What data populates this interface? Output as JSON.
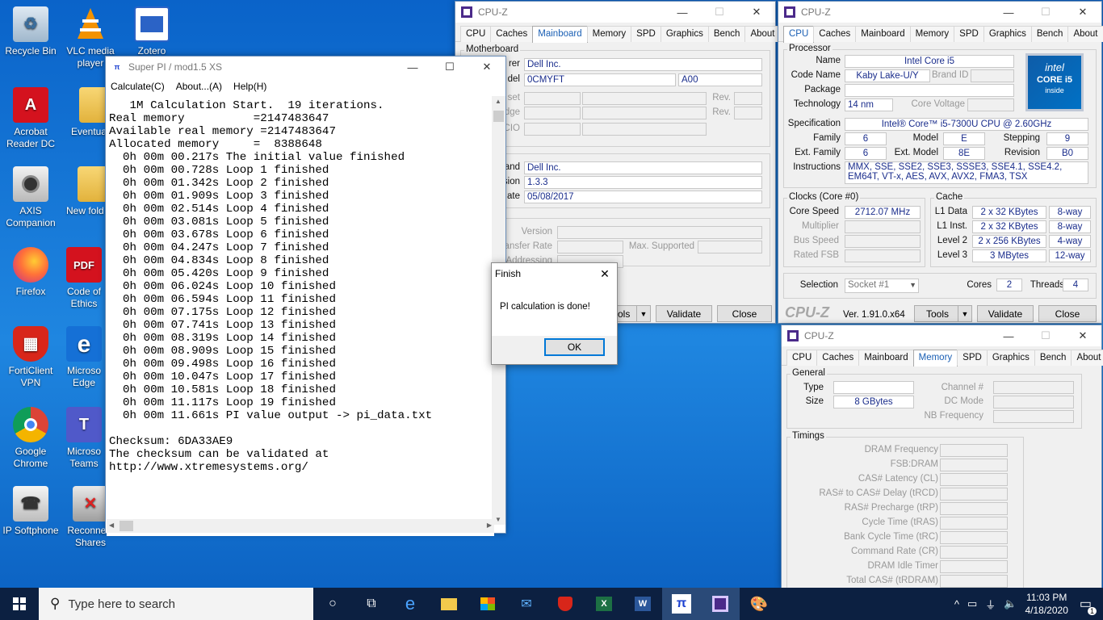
{
  "desktop": {
    "icons": [
      {
        "label": "Recycle Bin"
      },
      {
        "label": "VLC media player"
      },
      {
        "label": "Zotero"
      },
      {
        "label": "Acrobat Reader DC"
      },
      {
        "label": "Eventua"
      },
      {
        "label": "AXIS Companion"
      },
      {
        "label": "New fold"
      },
      {
        "label": "Firefox"
      },
      {
        "label": "Code of Ethics"
      },
      {
        "label": "FortiClient VPN"
      },
      {
        "label": "Microso Edge"
      },
      {
        "label": "Google Chrome"
      },
      {
        "label": "Microso Teams"
      },
      {
        "label": "IP Softphone"
      },
      {
        "label": "Reconnect Shares"
      }
    ]
  },
  "superpi": {
    "title": "Super PI / mod1.5 XS",
    "menu": [
      "Calculate(C)",
      "About...(A)",
      "Help(H)"
    ],
    "output": "   1M Calculation Start.  19 iterations.\nReal memory          =2147483647\nAvailable real memory =2147483647\nAllocated memory     =  8388648\n  0h 00m 00.217s The initial value finished\n  0h 00m 00.728s Loop 1 finished\n  0h 00m 01.342s Loop 2 finished\n  0h 00m 01.909s Loop 3 finished\n  0h 00m 02.514s Loop 4 finished\n  0h 00m 03.081s Loop 5 finished\n  0h 00m 03.678s Loop 6 finished\n  0h 00m 04.247s Loop 7 finished\n  0h 00m 04.834s Loop 8 finished\n  0h 00m 05.420s Loop 9 finished\n  0h 00m 06.024s Loop 10 finished\n  0h 00m 06.594s Loop 11 finished\n  0h 00m 07.175s Loop 12 finished\n  0h 00m 07.741s Loop 13 finished\n  0h 00m 08.319s Loop 14 finished\n  0h 00m 08.909s Loop 15 finished\n  0h 00m 09.498s Loop 16 finished\n  0h 00m 10.047s Loop 17 finished\n  0h 00m 10.581s Loop 18 finished\n  0h 00m 11.117s Loop 19 finished\n  0h 00m 11.661s PI value output -> pi_data.txt\n\nChecksum: 6DA33AE9\nThe checksum can be validated at\nhttp://www.xtremesystems.org/"
  },
  "dialog": {
    "title": "Finish",
    "message": "PI calculation is done!",
    "ok": "OK"
  },
  "cpuz_tabs": [
    "CPU",
    "Caches",
    "Mainboard",
    "Memory",
    "SPD",
    "Graphics",
    "Bench",
    "About"
  ],
  "cpuz_mb": {
    "title": "CPU-Z",
    "group_motherboard": "Motherboard",
    "l_manufacturer": "rer",
    "manufacturer": "Dell Inc.",
    "l_model": "del",
    "model": "0CMYFT",
    "model_rev": "A00",
    "l_chipset": "set",
    "l_southbridge": "dge",
    "l_lpcio": "CIO",
    "rev1": "Rev.",
    "rev2": "Rev.",
    "l_brand": "and",
    "brand": "Dell Inc.",
    "l_version": "sion",
    "version": "1.3.3",
    "l_date": "ate",
    "date": "05/08/2017",
    "group_interface": "nterface",
    "gi_version": "Version",
    "gi_transfer": "ansfer Rate",
    "gi_max": "Max. Supported",
    "gi_addressing": "Addressing",
    "tools": "ols",
    "validate": "Validate",
    "close": "Close"
  },
  "cpuz_cpu": {
    "title": "CPU-Z",
    "group_processor": "Processor",
    "name_l": "Name",
    "name": "Intel Core i5",
    "codename_l": "Code Name",
    "codename": "Kaby Lake-U/Y",
    "brandid_l": "Brand ID",
    "package_l": "Package",
    "technology_l": "Technology",
    "technology": "14 nm",
    "corevoltage_l": "Core Voltage",
    "spec_l": "Specification",
    "spec": "Intel® Core™ i5-7300U CPU @ 2.60GHz",
    "family_l": "Family",
    "family": "6",
    "model_l": "Model",
    "model": "E",
    "stepping_l": "Stepping",
    "stepping": "9",
    "extfamily_l": "Ext. Family",
    "extfamily": "6",
    "extmodel_l": "Ext. Model",
    "extmodel": "8E",
    "revision_l": "Revision",
    "revision": "B0",
    "instructions_l": "Instructions",
    "instructions": "MMX, SSE, SSE2, SSE3, SSSE3, SSE4.1, SSE4.2, EM64T, VT-x, AES, AVX, AVX2, FMA3, TSX",
    "clocks_group": "Clocks (Core #0)",
    "corespeed_l": "Core Speed",
    "corespeed": "2712.07 MHz",
    "multiplier_l": "Multiplier",
    "busspeed_l": "Bus Speed",
    "ratedfsb_l": "Rated FSB",
    "cache_group": "Cache",
    "l1d_l": "L1 Data",
    "l1d": "2 x 32 KBytes",
    "l1d_w": "8-way",
    "l1i_l": "L1 Inst.",
    "l1i": "2 x 32 KBytes",
    "l1i_w": "8-way",
    "l2_l": "Level 2",
    "l2": "2 x 256 KBytes",
    "l2_w": "4-way",
    "l3_l": "Level 3",
    "l3": "3 MBytes",
    "l3_w": "12-way",
    "selection_l": "Selection",
    "selection": "Socket #1",
    "cores_l": "Cores",
    "cores": "2",
    "threads_l": "Threads",
    "threads": "4",
    "logo": "CPU-Z",
    "ver": "Ver. 1.91.0.x64",
    "tools": "Tools",
    "validate": "Validate",
    "close": "Close",
    "badge_brand": "intel",
    "badge_core": "CORE i5",
    "badge_inside": "inside"
  },
  "cpuz_mem": {
    "title": "CPU-Z",
    "general_group": "General",
    "type_l": "Type",
    "size_l": "Size",
    "size": "8 GBytes",
    "channel_l": "Channel #",
    "dcmode_l": "DC Mode",
    "nbfreq_l": "NB Frequency",
    "timings_group": "Timings",
    "timings": [
      "DRAM Frequency",
      "FSB:DRAM",
      "CAS# Latency (CL)",
      "RAS# to CAS# Delay (tRCD)",
      "RAS# Precharge (tRP)",
      "Cycle Time (tRAS)",
      "Bank Cycle Time (tRC)",
      "Command Rate (CR)",
      "DRAM Idle Timer",
      "Total CAS# (tRDRAM)"
    ]
  },
  "taskbar": {
    "search_placeholder": "Type here to search",
    "time": "11:03 PM",
    "date": "4/18/2020",
    "notifications": "1"
  }
}
